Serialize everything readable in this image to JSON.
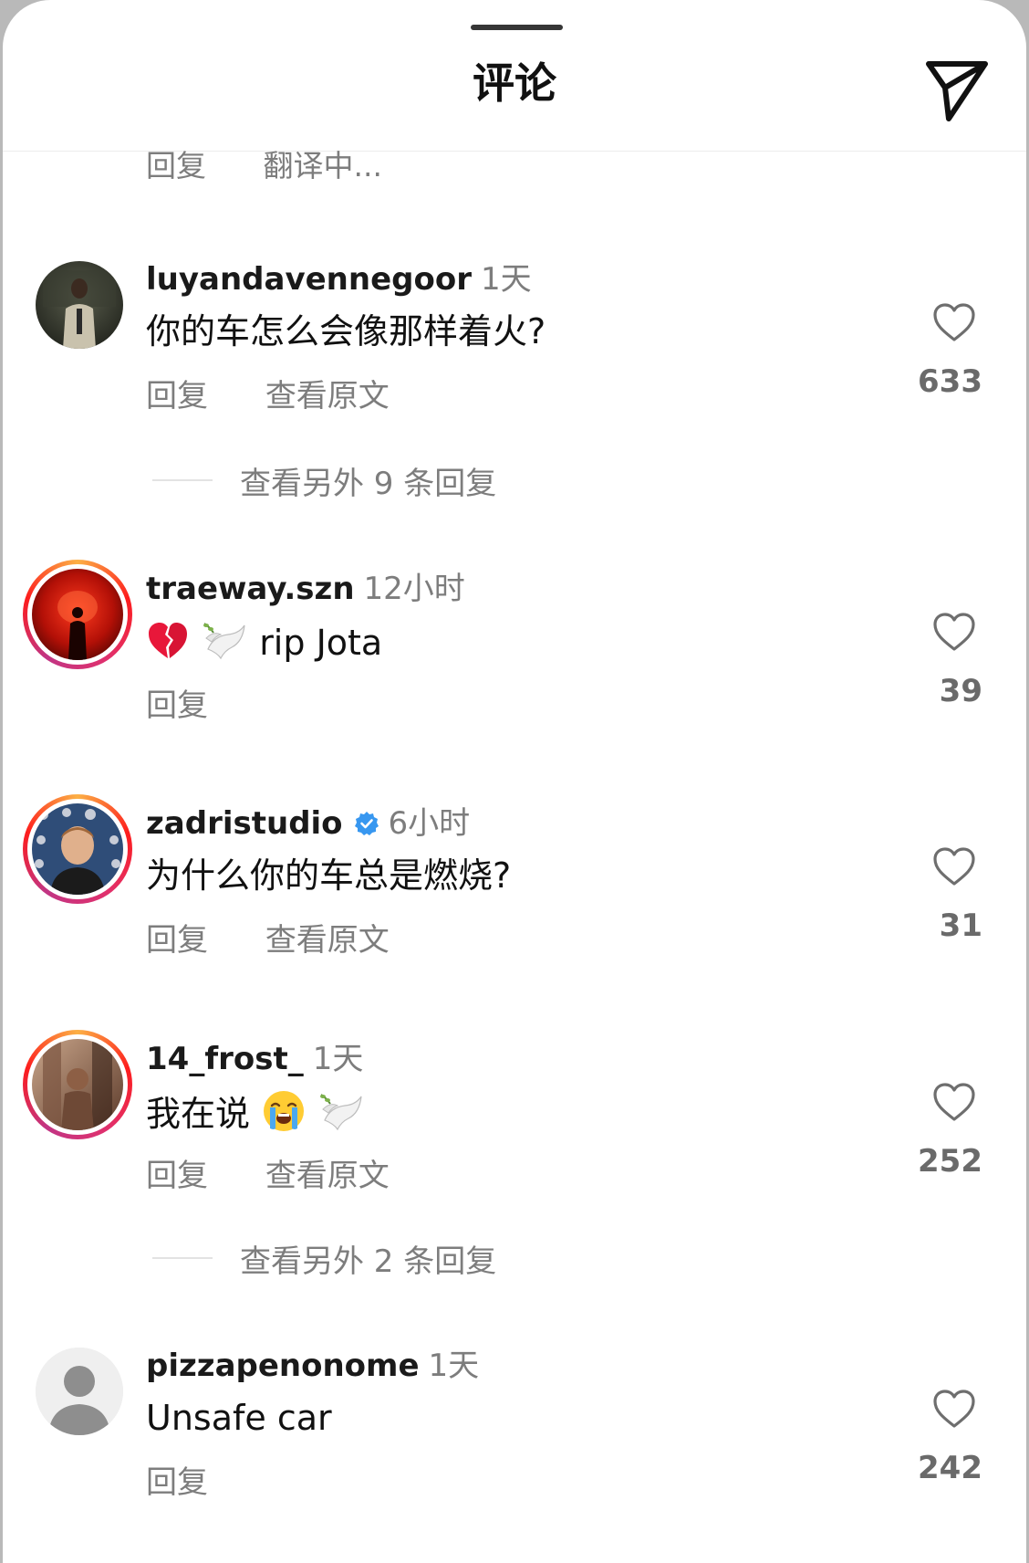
{
  "header": {
    "title": "评论",
    "send_icon": "send-icon"
  },
  "partial_comment": {
    "reply_label": "回复",
    "translate_label": "翻译中..."
  },
  "comments": [
    {
      "username": "luyandavennegoor",
      "time": "1天",
      "text": "你的车怎么会像那样着火?",
      "reply_label": "回复",
      "original_label": "查看原文",
      "likes": "633",
      "view_replies": "查看另外 9 条回复",
      "has_story_ring": false
    },
    {
      "username": "traeway.szn",
      "time": "12小时",
      "text_emojis": [
        "broken-heart-emoji",
        "dove-emoji"
      ],
      "text": "rip Jota",
      "reply_label": "回复",
      "likes": "39",
      "has_story_ring": true
    },
    {
      "username": "zadristudio",
      "verified": true,
      "time": "6小时",
      "text": "为什么你的车总是燃烧?",
      "reply_label": "回复",
      "original_label": "查看原文",
      "likes": "31",
      "has_story_ring": true
    },
    {
      "username": "14_frost_",
      "time": "1天",
      "text": "我在说",
      "text_emojis": [
        "loudly-crying-face-emoji",
        "dove-emoji"
      ],
      "reply_label": "回复",
      "original_label": "查看原文",
      "likes": "252",
      "view_replies": "查看另外 2 条回复",
      "has_story_ring": true
    },
    {
      "username": "pizzapenonome",
      "time": "1天",
      "text": "Unsafe car",
      "reply_label": "回复",
      "likes": "242",
      "has_story_ring": false
    }
  ],
  "colors": {
    "secondary_text": "#7d7d7d",
    "verified_blue": "#3797f0",
    "story_ring": [
      "#fcb045",
      "#fd1d1d",
      "#e1306c",
      "#c13584"
    ]
  }
}
